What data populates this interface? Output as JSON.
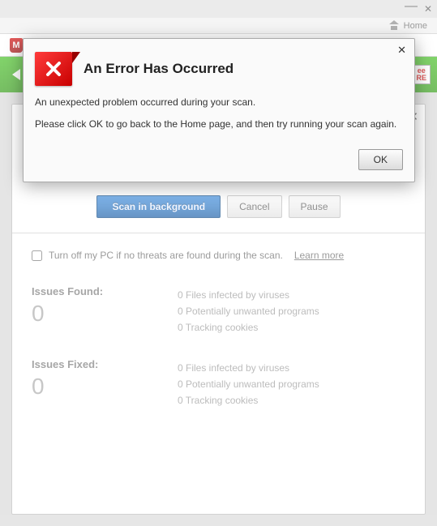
{
  "window": {
    "home_label": "Home",
    "logo_letter": "M"
  },
  "scan": {
    "scan_bg_label": "Scan in background",
    "cancel_label": "Cancel",
    "pause_label": "Pause",
    "turnoff_label": "Turn off my PC if no threats are found during the scan.",
    "learnmore_label": "Learn more"
  },
  "issues_found": {
    "title": "Issues Found:",
    "count": "0",
    "line1": "0 Files infected by viruses",
    "line2": "0 Potentially unwanted programs",
    "line3": "0 Tracking cookies"
  },
  "issues_fixed": {
    "title": "Issues Fixed:",
    "count": "0",
    "line1": "0 Files infected by viruses",
    "line2": "0 Potentially unwanted programs",
    "line3": "0 Tracking cookies"
  },
  "free_badge": {
    "line1": "ee",
    "line2": "RE"
  },
  "modal": {
    "title": "An Error Has Occurred",
    "line1": "An unexpected problem occurred during your scan.",
    "line2": "Please click OK to go back to the Home page, and then try running your scan again.",
    "ok_label": "OK"
  }
}
